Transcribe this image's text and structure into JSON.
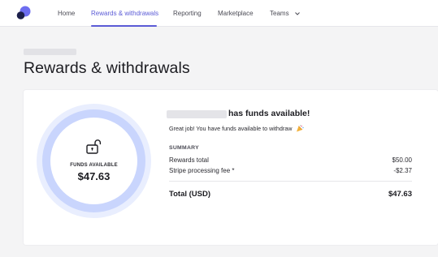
{
  "nav": {
    "home": "Home",
    "rewards": "Rewards & withdrawals",
    "reporting": "Reporting",
    "marketplace": "Marketplace",
    "teams": "Teams"
  },
  "page": {
    "title": "Rewards & withdrawals"
  },
  "funds_card": {
    "label": "FUNDS AVAILABLE",
    "amount": "$47.63"
  },
  "details": {
    "heading": "has funds available!",
    "message": "Great job! You have funds available to withdraw",
    "summary_label": "SUMMARY",
    "rows": [
      {
        "label": "Rewards total",
        "value": "$50.00"
      },
      {
        "label": "Stripe processing fee *",
        "value": "-$2.37"
      }
    ],
    "total": {
      "label": "Total (USD)",
      "value": "$47.63"
    }
  },
  "colors": {
    "accent": "#5b5bd6",
    "ring_outer": "#e9eefe",
    "ring_mid": "#c9d5fd",
    "logo_dark": "#1c1f4a",
    "logo_light": "#6d6df0"
  },
  "icons": [
    "logo-icon",
    "chevron-down-icon",
    "unlock-icon",
    "party-popper-icon"
  ]
}
